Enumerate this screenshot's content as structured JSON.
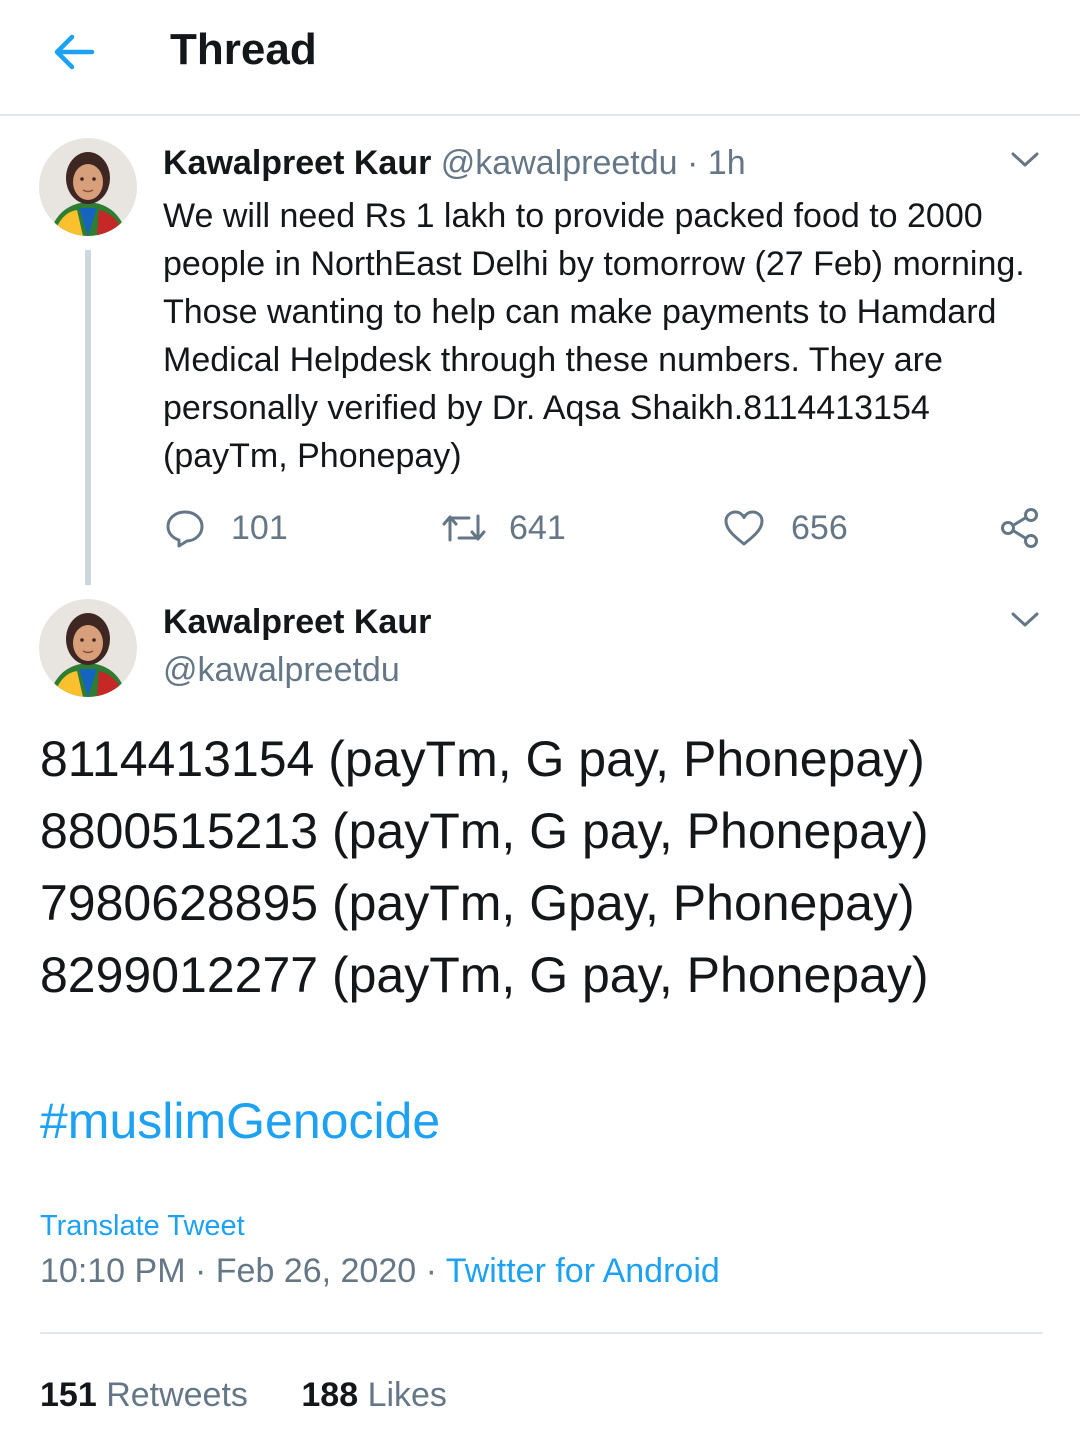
{
  "header": {
    "title": "Thread",
    "back_icon": "arrow-left-icon"
  },
  "colors": {
    "accent": "#1da1f2",
    "secondary_text": "#657786",
    "primary_text": "#14171a",
    "divider": "#e1e8ed",
    "thread_line": "#ccd6dd"
  },
  "tweet1": {
    "name": "Kawalpreet Kaur",
    "handle": "@kawalpreetdu",
    "separator": "·",
    "time": "1h",
    "text": "We will need Rs 1 lakh to provide packed food to 2000 people in NorthEast Delhi by tomorrow (27 Feb) morning. Those wanting to help can make payments to Hamdard Medical Helpdesk through these numbers. They are personally verified by Dr. Aqsa Shaikh.8114413154 (payTm, Phonepay)",
    "actions": {
      "replies": "101",
      "retweets": "641",
      "likes": "656"
    }
  },
  "tweet2": {
    "name": "Kawalpreet Kaur",
    "handle": "@kawalpreetdu",
    "lines": [
      "8114413154 (payTm, G pay, Phonepay)",
      "8800515213 (payTm, G pay, Phonepay)",
      "7980628895 (payTm, Gpay, Phonepay)",
      "8299012277 (payTm, G pay, Phonepay)"
    ],
    "hashtag": "#muslimGenocide",
    "translate_label": "Translate Tweet",
    "time": "10:10 PM",
    "separator": "·",
    "date": "Feb 26, 2020",
    "source": "Twitter for Android",
    "stats": {
      "retweets_count": "151",
      "retweets_label": "Retweets",
      "likes_count": "188",
      "likes_label": "Likes"
    }
  }
}
